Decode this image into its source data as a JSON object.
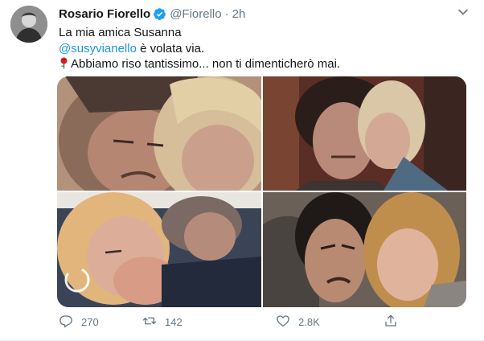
{
  "author": {
    "display_name": "Rosario Fiorello",
    "handle": "@Fiorello",
    "separator": "·",
    "time": "2h",
    "verified": true
  },
  "text": {
    "line1": "La mia amica Susanna",
    "mention": "@susyvianello",
    "line2_rest": " è volata via.",
    "line3": "Abbiamo riso tantissimo... non ti dimenticherò mai.",
    "line3_emoji": "rose-icon"
  },
  "media": {
    "photo_count": 4,
    "loading_indicator": "spinner-icon"
  },
  "actions": {
    "replies": "270",
    "retweets": "142",
    "likes": "2.8K"
  },
  "colors": {
    "link": "#1b95e0",
    "secondary_text": "#657786",
    "verified_badge": "#1da1f2"
  }
}
